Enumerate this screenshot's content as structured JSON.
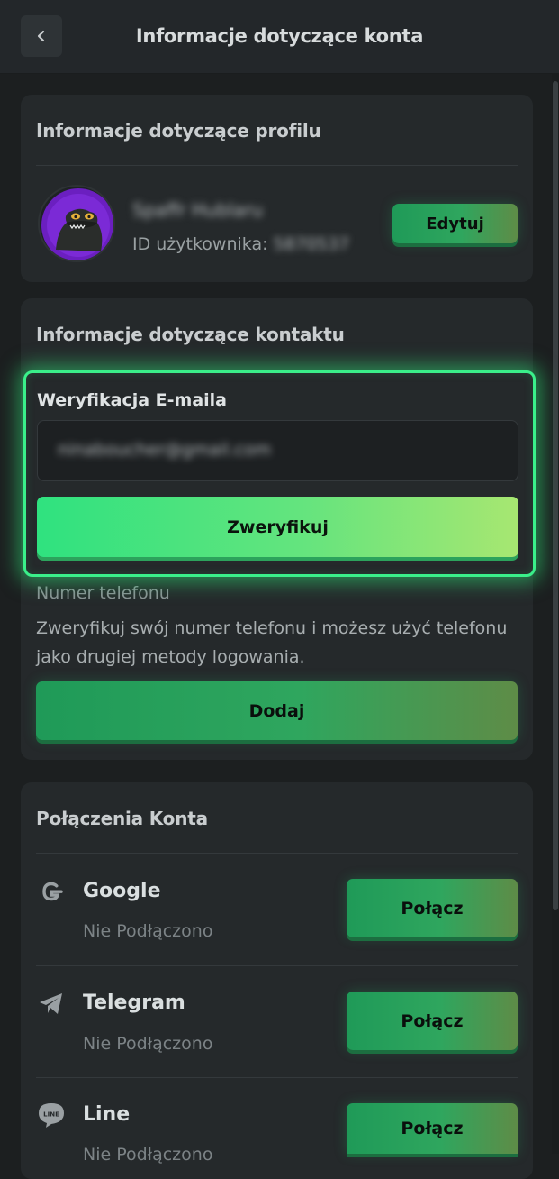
{
  "header": {
    "title": "Informacje dotyczące konta",
    "back_icon": "chevron-left-icon"
  },
  "profile": {
    "title": "Informacje dotyczące profilu",
    "username": "Spaffr Hublaru",
    "user_id_label": "ID użytkownika:",
    "user_id_value": "5870537",
    "edit_label": "Edytuj"
  },
  "contact": {
    "title": "Informacje dotyczące kontaktu",
    "email_section_label": "Weryfikacja E-maila",
    "email_value": "ninaboucher@gmail.com",
    "verify_label": "Zweryfikuj",
    "phone_label": "Numer telefonu",
    "phone_description": "Zweryfikuj swój numer telefonu i możesz użyć telefonu jako drugiej metody logowania.",
    "add_label": "Dodaj"
  },
  "connections": {
    "title": "Połączenia Konta",
    "items": [
      {
        "name": "Google",
        "status": "Nie Podłączono",
        "button": "Połącz",
        "icon": "google-icon"
      },
      {
        "name": "Telegram",
        "status": "Nie Podłączono",
        "button": "Połącz",
        "icon": "telegram-icon"
      },
      {
        "name": "Line",
        "status": "Nie Podłączono",
        "button": "Połącz",
        "icon": "line-icon"
      }
    ]
  },
  "colors": {
    "accent_green": "#3af08a",
    "background": "#1c1f20",
    "card": "#25292b"
  }
}
